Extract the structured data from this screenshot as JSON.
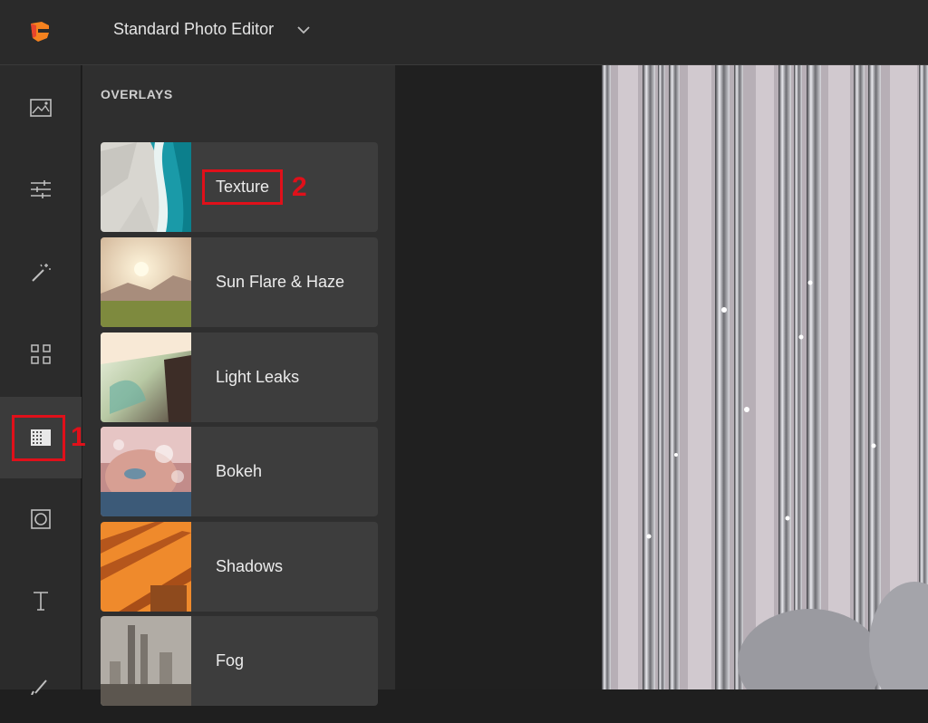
{
  "app": {
    "title": "Standard Photo Editor"
  },
  "panel": {
    "title": "OVERLAYS",
    "items": [
      {
        "label": "Texture"
      },
      {
        "label": "Sun Flare & Haze"
      },
      {
        "label": "Light Leaks"
      },
      {
        "label": "Bokeh"
      },
      {
        "label": "Shadows"
      },
      {
        "label": "Fog"
      }
    ]
  },
  "rail": {
    "icons": [
      "image-icon",
      "adjust-sliders-icon",
      "magic-wand-icon",
      "grid-icon",
      "overlays-icon",
      "frame-icon",
      "text-icon",
      "brush-icon"
    ],
    "active": "overlays-icon"
  },
  "annotations": {
    "step1": "1",
    "step2": "2"
  },
  "colors": {
    "accent": "#e0101a",
    "logo_orange": "#f5821f",
    "logo_red": "#e8452c"
  }
}
